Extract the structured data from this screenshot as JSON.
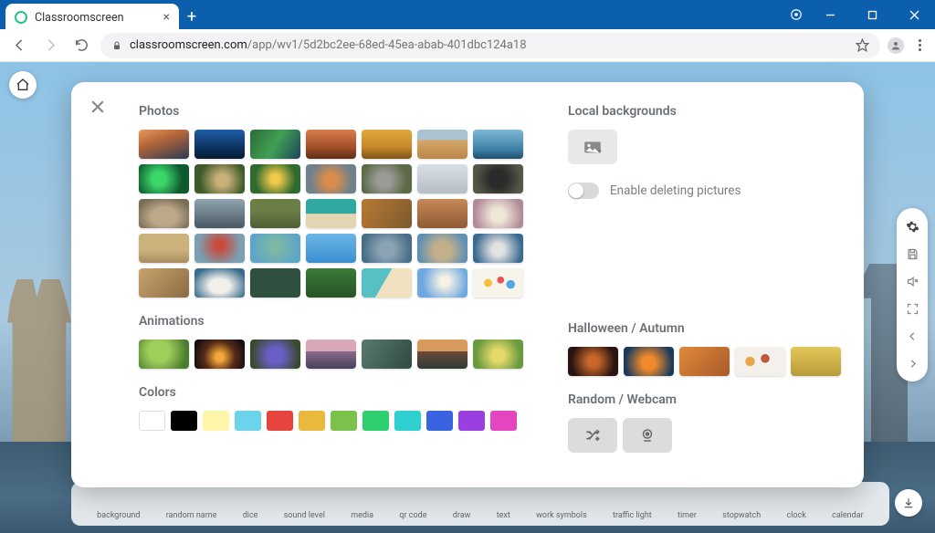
{
  "browser": {
    "tab_title": "Classroomscreen",
    "url_host": "classroomscreen.com",
    "url_path": "/app/wv1/5d2bc2ee-68ed-45ea-abab-401dbc124a18"
  },
  "modal": {
    "photos_heading": "Photos",
    "photos": [
      {
        "name": "mountain-sunset",
        "bg": "linear-gradient(160deg,#e79a5b 0%,#b06438 40%,#2b3a55 100%)"
      },
      {
        "name": "blue-mountain",
        "bg": "linear-gradient(#1f5fa7,#0a2d55 70%,#071b33)"
      },
      {
        "name": "green-cliff",
        "bg": "linear-gradient(120deg,#2d6b3a 0%,#3fa053 50%,#1e445c 100%)"
      },
      {
        "name": "canyon",
        "bg": "linear-gradient(#d77d4c,#a24f2a 60%,#5e2e19)"
      },
      {
        "name": "golden-coast",
        "bg": "linear-gradient(#e0a93e,#c78728 60%,#7a5519)"
      },
      {
        "name": "desert",
        "bg": "linear-gradient(#a9c3d1 35%,#d4a767 36%,#b9864a)"
      },
      {
        "name": "iceberg",
        "bg": "linear-gradient(#7fb8d6,#3a7fa3 70%,#1f4e68)"
      },
      {
        "name": "parrot",
        "bg": "radial-gradient(circle at 40% 50%,#3dd66a 0 20%,#0d5a2f 70%)"
      },
      {
        "name": "squirrel",
        "bg": "radial-gradient(circle at 55% 55%,#c9b07a 0 18%,#3f5b2a 70%)"
      },
      {
        "name": "butterfly",
        "bg": "radial-gradient(circle at 50% 50%,#f0c94a 0 15%,#2f6a2f 70%)"
      },
      {
        "name": "fox",
        "bg": "radial-gradient(circle at 50% 55%,#d98c4a 0 20%,#70818c 70%)"
      },
      {
        "name": "koala",
        "bg": "radial-gradient(circle at 45% 55%,#9a9a96 0 22%,#5c6a46 70%)"
      },
      {
        "name": "birds",
        "bg": "linear-gradient(#d9e0e5,#b4bec6)"
      },
      {
        "name": "panther",
        "bg": "radial-gradient(circle at 50% 50%,#2b2b2b 0 30%,#565749 80%)"
      },
      {
        "name": "colosseum",
        "bg": "radial-gradient(ellipse at 50% 60%,#bda98a 0 35%,#7a6c55 80%)"
      },
      {
        "name": "mountain-gray",
        "bg": "linear-gradient(#8fa4b0,#485863)"
      },
      {
        "name": "pyramid-mexico",
        "bg": "linear-gradient(#6b7e46 40%,#4e5e34)"
      },
      {
        "name": "beach",
        "bg": "linear-gradient(#2fa89f 50%,#e2d5b2 51%)"
      },
      {
        "name": "autumn-forest",
        "bg": "linear-gradient(120deg,#b77a35,#7d5a2d)"
      },
      {
        "name": "petra",
        "bg": "linear-gradient(#c68958,#8f5a34)"
      },
      {
        "name": "taj-mahal",
        "bg": "radial-gradient(circle at 50% 55%,#efe6d8 0 22%,#b28a9a 80%)"
      },
      {
        "name": "pyramids",
        "bg": "linear-gradient(#cbb27d 55%,#a88c5c)"
      },
      {
        "name": "golden-gate",
        "bg": "radial-gradient(circle at 50% 40%,#c94a3b 0 12%,#7aa0b2 70%)"
      },
      {
        "name": "statue-liberty",
        "bg": "radial-gradient(circle at 50% 45%,#7fb8a5 0 12%,#5ea6c6 75%)"
      },
      {
        "name": "blue-sky",
        "bg": "linear-gradient(#6bb6e8,#3b8fd0)"
      },
      {
        "name": "tower-bridge",
        "bg": "radial-gradient(circle at 50% 55%,#8aa3b5 0 25%,#4a6d86 80%)"
      },
      {
        "name": "brandenburg",
        "bg": "radial-gradient(circle at 50% 58%,#c2b08a 0 28%,#6090b5 80%)"
      },
      {
        "name": "sydney",
        "bg": "radial-gradient(circle at 50% 55%,#e2e2e2 0 20%,#3a6a90 80%)"
      },
      {
        "name": "music-vintage",
        "bg": "linear-gradient(135deg,#c9a36e,#8a6b43)"
      },
      {
        "name": "open-book",
        "bg": "radial-gradient(ellipse at 50% 60%,#f2f0ea 0 28%,#3a6c8e 80%)"
      },
      {
        "name": "chalkboard",
        "bg": "#2f4f3f"
      },
      {
        "name": "grass",
        "bg": "linear-gradient(#3a7a38,#265425)"
      },
      {
        "name": "beach-top",
        "bg": "linear-gradient(120deg,#57c0c4 45%,#f0e2c1 46%)"
      },
      {
        "name": "moon",
        "bg": "radial-gradient(circle at 55% 45%,#f5f2e5 0 14%,#6fa7e0 70%)"
      },
      {
        "name": "balloons",
        "bg": "radial-gradient(circle at 30% 50%,#f3c23a 0 10%,transparent 11%),radial-gradient(circle at 55% 40%,#e85252 0 10%,transparent 11%),radial-gradient(circle at 75% 55%,#4fa8e0 0 10%,transparent 11%),#f7f4ec"
      }
    ],
    "animations_heading": "Animations",
    "animations": [
      {
        "name": "green-leaves",
        "bg": "radial-gradient(circle at 40% 40%,#9fce5a 0 30%,#4c7c2e 80%)"
      },
      {
        "name": "campfire",
        "bg": "radial-gradient(circle at 50% 60%,#f4a93a 0 12%,#582d16 50%,#0c0c12 90%)"
      },
      {
        "name": "bluebells",
        "bg": "radial-gradient(circle at 50% 55%,#6a5fc7 0 25%,#3a4a2e 80%)"
      },
      {
        "name": "lighthouse",
        "bg": "linear-gradient(#d8a8b7 40%,#8a6a8a 41%,#47405a)"
      },
      {
        "name": "waterfall",
        "bg": "linear-gradient(120deg,#5a7a6e,#2f4a40)"
      },
      {
        "name": "tropical-sunset",
        "bg": "linear-gradient(#d89a5c 40%,#6a4a3a 41%,#2f3a34)"
      },
      {
        "name": "spring-field",
        "bg": "radial-gradient(circle at 50% 55%,#e4da6a 0 20%,#6a9a3f 75%)"
      }
    ],
    "colors_heading": "Colors",
    "colors": [
      "#ffffff",
      "#000000",
      "#fdf6a8",
      "#6bd3ea",
      "#e6443c",
      "#e8b93c",
      "#7ac24a",
      "#2ecf6e",
      "#2ed1cf",
      "#3a63e0",
      "#9a3fe0",
      "#e446c0"
    ],
    "local_heading": "Local backgrounds",
    "toggle_label": "Enable deleting pictures",
    "halloween_heading": "Halloween / Autumn",
    "halloween": [
      {
        "name": "halloween-street",
        "bg": "radial-gradient(circle at 50% 50%,#c9672b 0 18%,#2a1410 75%)"
      },
      {
        "name": "pumpkin",
        "bg": "radial-gradient(circle at 50% 55%,#f08a2c 0 22%,#1a3a5a 80%)"
      },
      {
        "name": "leaf-macro",
        "bg": "linear-gradient(135deg,#e08a3c,#a85a28)"
      },
      {
        "name": "leaves-white",
        "bg": "radial-gradient(circle at 30% 50%,#e6a84a 0 12%,transparent 13%),radial-gradient(circle at 60% 40%,#c05a3a 0 12%,transparent 13%),#f4f1ec"
      },
      {
        "name": "yellow-field",
        "bg": "linear-gradient(#e4c85a,#b89a3a)"
      }
    ],
    "random_heading": "Random / Webcam"
  },
  "bottom_tools": [
    "background",
    "random name",
    "dice",
    "sound level",
    "media",
    "qr code",
    "draw",
    "text",
    "work symbols",
    "traffic light",
    "timer",
    "stopwatch",
    "clock",
    "calendar"
  ]
}
